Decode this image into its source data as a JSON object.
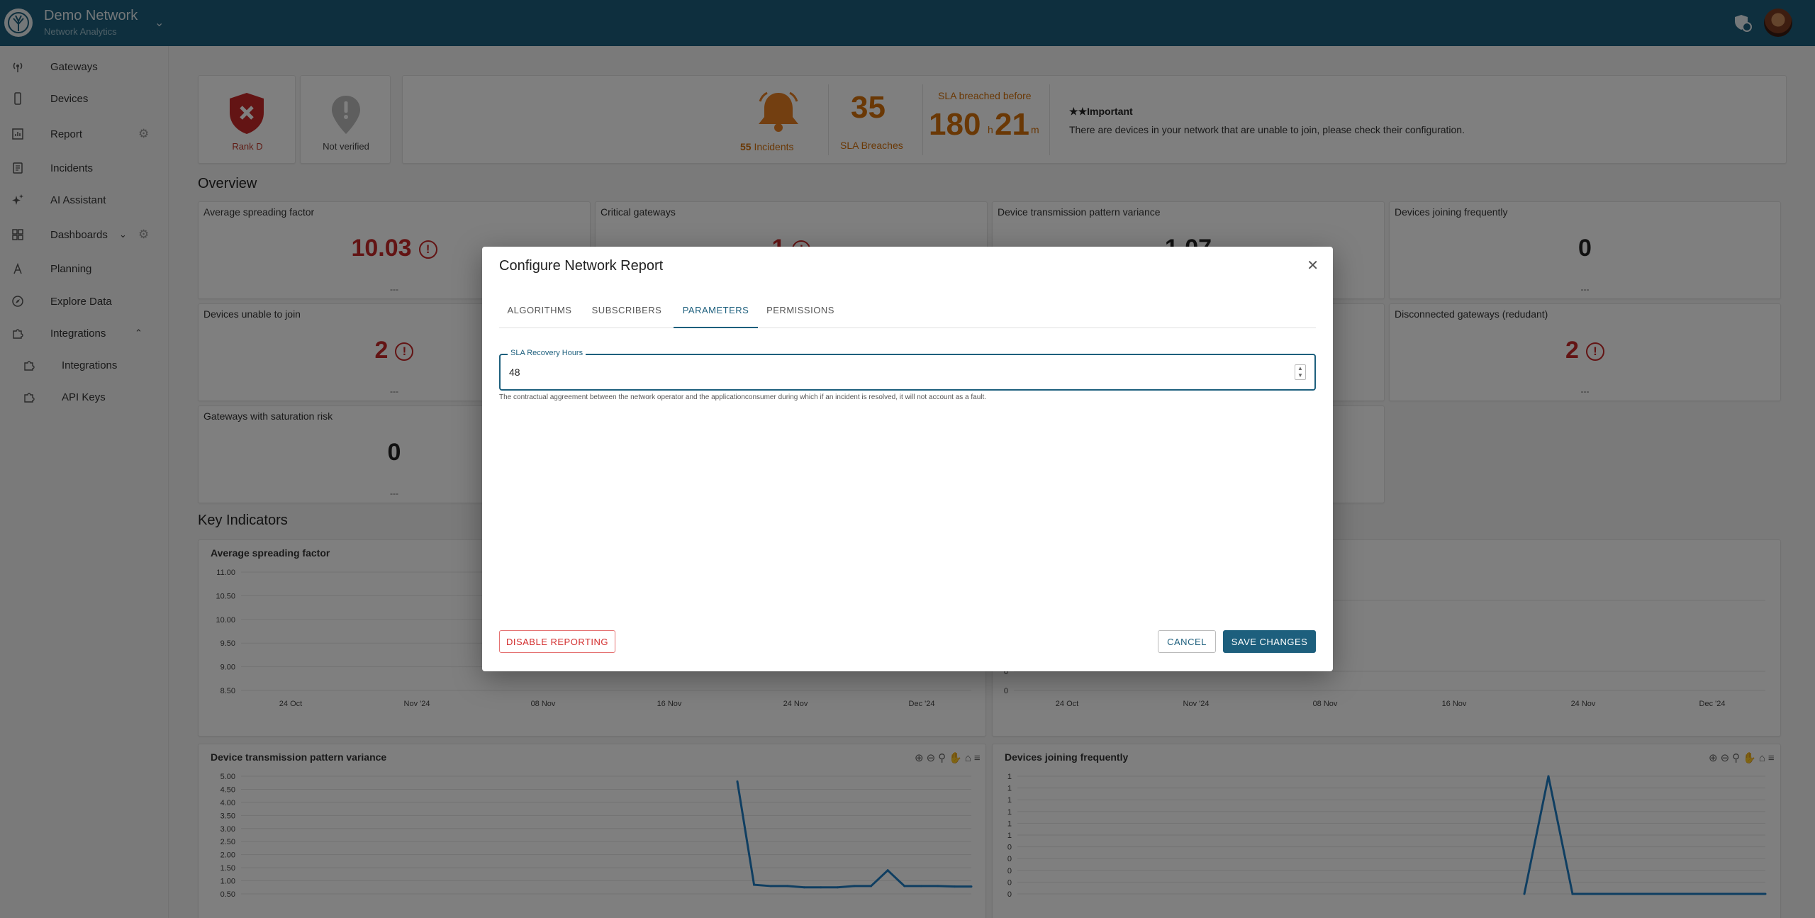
{
  "header": {
    "title": "Demo Network",
    "subtitle": "Network Analytics"
  },
  "sidebar": {
    "items": [
      {
        "label": "Gateways",
        "icon": "antenna-icon"
      },
      {
        "label": "Devices",
        "icon": "phone-icon"
      },
      {
        "label": "Report",
        "icon": "report-icon"
      },
      {
        "label": "Incidents",
        "icon": "incidents-icon"
      },
      {
        "label": "AI Assistant",
        "icon": "sparkle-icon"
      },
      {
        "label": "Dashboards",
        "icon": "dashboard-icon"
      },
      {
        "label": "Planning",
        "icon": "planning-icon"
      },
      {
        "label": "Explore Data",
        "icon": "compass-icon"
      },
      {
        "label": "Integrations",
        "icon": "puzzle-icon"
      }
    ],
    "sub_items": [
      {
        "label": "Integrations",
        "icon": "puzzle-icon"
      },
      {
        "label": "API Keys",
        "icon": "puzzle-icon"
      }
    ]
  },
  "status": {
    "rank": "Rank D",
    "verified": "Not verified",
    "incidents_count": "55",
    "incidents_label": "Incidents",
    "sla_breaches_count": "35",
    "sla_breaches_label": "SLA Breaches",
    "sla_breached_before_label": "SLA breached before",
    "sla_hours": "180",
    "sla_h_unit": "h",
    "sla_minutes": "21",
    "sla_m_unit": "m",
    "important_title": "Important",
    "important_text": "There are devices in your network that are unable to join, please check their configuration."
  },
  "overview": {
    "title": "Overview",
    "metrics": [
      {
        "title": "Average spreading factor",
        "value": "10.03",
        "foot": "---"
      },
      {
        "title": "Critical gateways",
        "value": "1",
        "foot": ""
      },
      {
        "title": "Device transmission pattern variance",
        "value": "1.07",
        "foot": ""
      },
      {
        "title": "Devices joining frequently",
        "value": "0",
        "foot": "---"
      },
      {
        "title": "Devices unable to join",
        "value": "2",
        "foot": "---"
      },
      {
        "title": "Disconnected gateways (redudant)",
        "value": "2",
        "foot": "---"
      },
      {
        "title": "Gateways with saturation risk",
        "value": "0",
        "foot": "---"
      }
    ]
  },
  "key_indicators": {
    "title": "Key Indicators",
    "charts": [
      {
        "title": "Average spreading factor"
      },
      {
        "title": "Device transmission pattern variance"
      },
      {
        "title": "Devices joining frequently"
      }
    ]
  },
  "chart_data": [
    {
      "type": "line",
      "title": "Average spreading factor",
      "x_ticks": [
        "24 Oct",
        "Nov '24",
        "08 Nov",
        "16 Nov",
        "24 Nov",
        "Dec '24"
      ],
      "y_ticks": [
        "11.00",
        "10.50",
        "10.00",
        "9.50",
        "9.00",
        "8.50"
      ],
      "ylim": [
        8.5,
        11.0
      ]
    },
    {
      "type": "line",
      "title": "",
      "x_ticks": [
        "24 Oct",
        "Nov '24",
        "08 Nov",
        "16 Nov",
        "24 Nov",
        "Dec '24"
      ],
      "y_ticks": [
        "1",
        "0",
        "0"
      ]
    },
    {
      "type": "line",
      "title": "Device transmission pattern variance",
      "y_ticks": [
        "5.00",
        "4.50",
        "4.00",
        "3.50",
        "3.00",
        "2.50",
        "2.00",
        "1.50",
        "1.00",
        "0.50"
      ],
      "ylim": [
        0.5,
        5.0
      ],
      "series": [
        {
          "values": [
            4.8,
            0.85,
            0.8,
            0.8,
            0.75,
            0.75,
            0.75,
            0.8,
            0.8,
            1.4,
            0.8,
            0.8,
            0.8,
            0.78,
            0.78
          ]
        }
      ]
    },
    {
      "type": "line",
      "title": "Devices joining frequently",
      "y_ticks": [
        "1",
        "1",
        "1",
        "1",
        "1",
        "1",
        "0",
        "0",
        "0",
        "0",
        "0"
      ],
      "series": [
        {
          "values": [
            0,
            1,
            0,
            0,
            0,
            0,
            0,
            0,
            0,
            0,
            0
          ]
        }
      ]
    }
  ],
  "modal": {
    "title": "Configure Network Report",
    "tabs": [
      "ALGORITHMS",
      "SUBSCRIBERS",
      "PARAMETERS",
      "PERMISSIONS"
    ],
    "active_tab": "PARAMETERS",
    "field_label": "SLA Recovery Hours",
    "field_value": "48",
    "helper": "The contractual aggreement between the network operator and the applicationconsumer during which if an incident is resolved, it will not account as a fault.",
    "disable_label": "DISABLE REPORTING",
    "cancel_label": "CANCEL",
    "save_label": "SAVE CHANGES"
  },
  "colors": {
    "brand": "#1d5f7d",
    "danger": "#c62828",
    "warning": "#d4700b",
    "line": "#1f7cc2"
  }
}
